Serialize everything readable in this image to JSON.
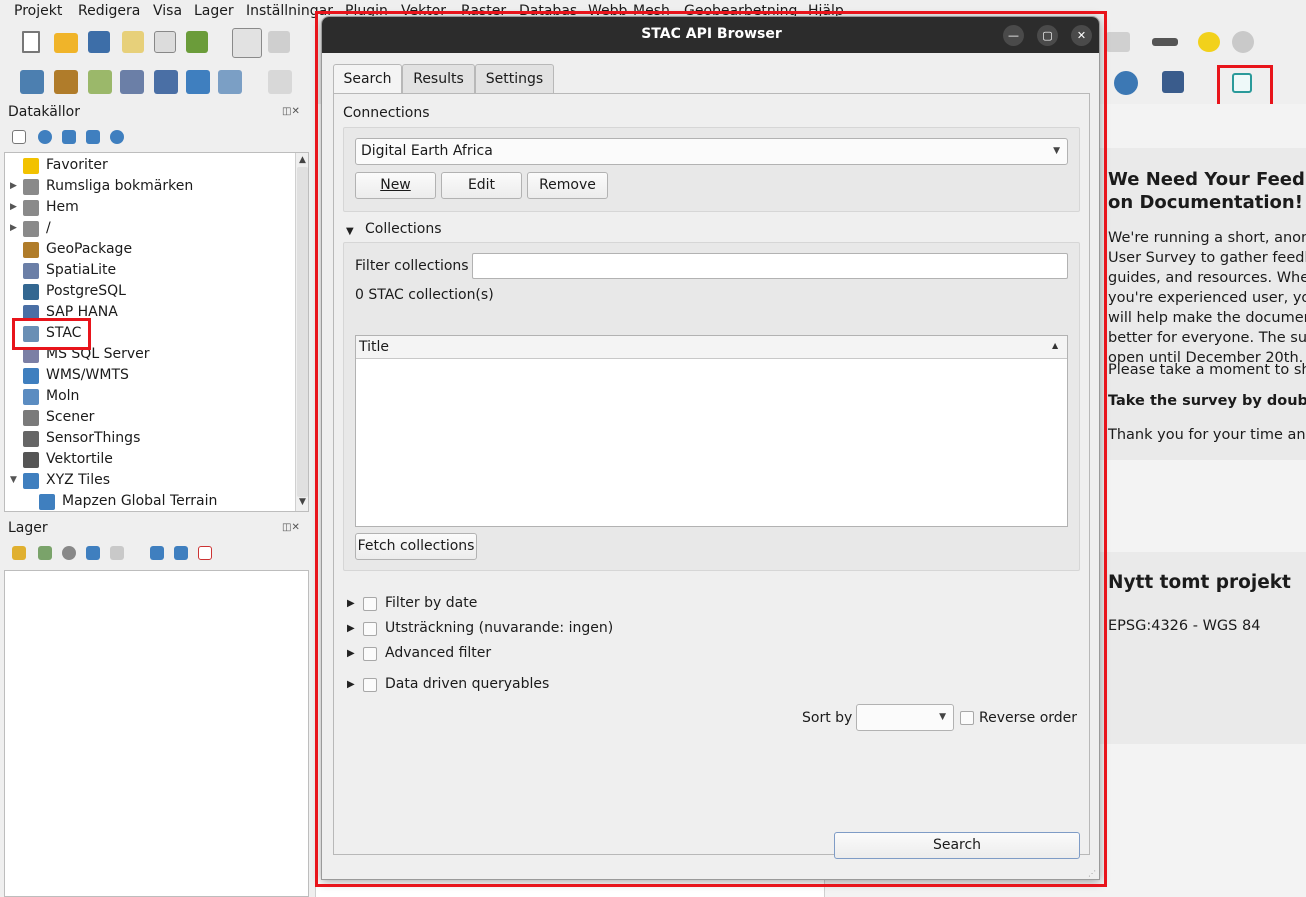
{
  "menu": [
    "Projekt",
    "Redigera",
    "Visa",
    "Lager",
    "Inställningar",
    "Plugin",
    "Vektor",
    "Raster",
    "Databas",
    "Webb",
    "Mesh",
    "Geobearbetning",
    "Hjälp"
  ],
  "browser_panel": {
    "title": "Datakällor",
    "items": [
      {
        "label": "Favoriter",
        "icon": "star-icon",
        "color": "#f2c200"
      },
      {
        "label": "Rumsliga bokmärken",
        "icon": "bookmark-icon",
        "color": "#8a8a8a"
      },
      {
        "label": "Hem",
        "icon": "home-folder-icon",
        "color": "#8a8a8a"
      },
      {
        "label": "/",
        "icon": "folder-icon",
        "color": "#8a8a8a"
      },
      {
        "label": "GeoPackage",
        "icon": "geopackage-icon",
        "color": "#b07c2a"
      },
      {
        "label": "SpatiaLite",
        "icon": "spatialite-icon",
        "color": "#6b7fa7"
      },
      {
        "label": "PostgreSQL",
        "icon": "postgresql-icon",
        "color": "#336791"
      },
      {
        "label": "SAP HANA",
        "icon": "sap-hana-icon",
        "color": "#4a6fa5"
      },
      {
        "label": "STAC",
        "icon": "stac-icon",
        "color": "#6a8fb5"
      },
      {
        "label": "MS SQL Server",
        "icon": "mssql-icon",
        "color": "#7b7fa5"
      },
      {
        "label": "WMS/WMTS",
        "icon": "globe-icon",
        "color": "#3f7fbf"
      },
      {
        "label": "Moln",
        "icon": "cloud-icon",
        "color": "#5b8cc1"
      },
      {
        "label": "Scener",
        "icon": "scene-icon",
        "color": "#7a7a7a"
      },
      {
        "label": "SensorThings",
        "icon": "sensor-icon",
        "color": "#666666"
      },
      {
        "label": "Vektortile",
        "icon": "vector-tile-icon",
        "color": "#555555"
      },
      {
        "label": "XYZ Tiles",
        "icon": "xyz-tiles-icon",
        "color": "#3f7fbf"
      },
      {
        "label": "Mapzen Global Terrain",
        "icon": "xyz-tiles-icon",
        "color": "#3f7fbf"
      }
    ]
  },
  "layers_panel": {
    "title": "Lager"
  },
  "news": {
    "heading": "We Need Your Feedback on Documentation!",
    "paragraph1": "We're running a short, anonymous User Survey to gather feedback on guides, and resources. Whether you're experienced user, your input will help make the documentation better for everyone. The survey is open until December 20th.",
    "paragraph2": "Please take a moment to share your thoughts.",
    "paragraph3": "Take the survey by double-clicking here.",
    "paragraph4": "Thank you for your time and support!"
  },
  "project": {
    "title": "Nytt tomt projekt",
    "crs": "EPSG:4326 - WGS 84"
  },
  "dialog": {
    "title": "STAC API Browser",
    "tabs": [
      "Search",
      "Results",
      "Settings"
    ],
    "connections_label": "Connections",
    "connection_selected": "Digital Earth Africa",
    "new_button": "New",
    "edit_button": "Edit",
    "remove_button": "Remove",
    "collections_label": "Collections",
    "filter_collections_label": "Filter collections",
    "collection_count": "0 STAC collection(s)",
    "table_header": "Title",
    "fetch_button": "Fetch collections",
    "filter_by_date": "Filter by date",
    "extent": "Utsträckning (nuvarande: ingen)",
    "advanced_filter": "Advanced filter",
    "data_driven": "Data driven queryables",
    "sort_by": "Sort by",
    "reverse_order": "Reverse order",
    "search_button": "Search"
  },
  "colors": {
    "highlight": "#e8141b",
    "titlebar": "#2c2c2c"
  }
}
